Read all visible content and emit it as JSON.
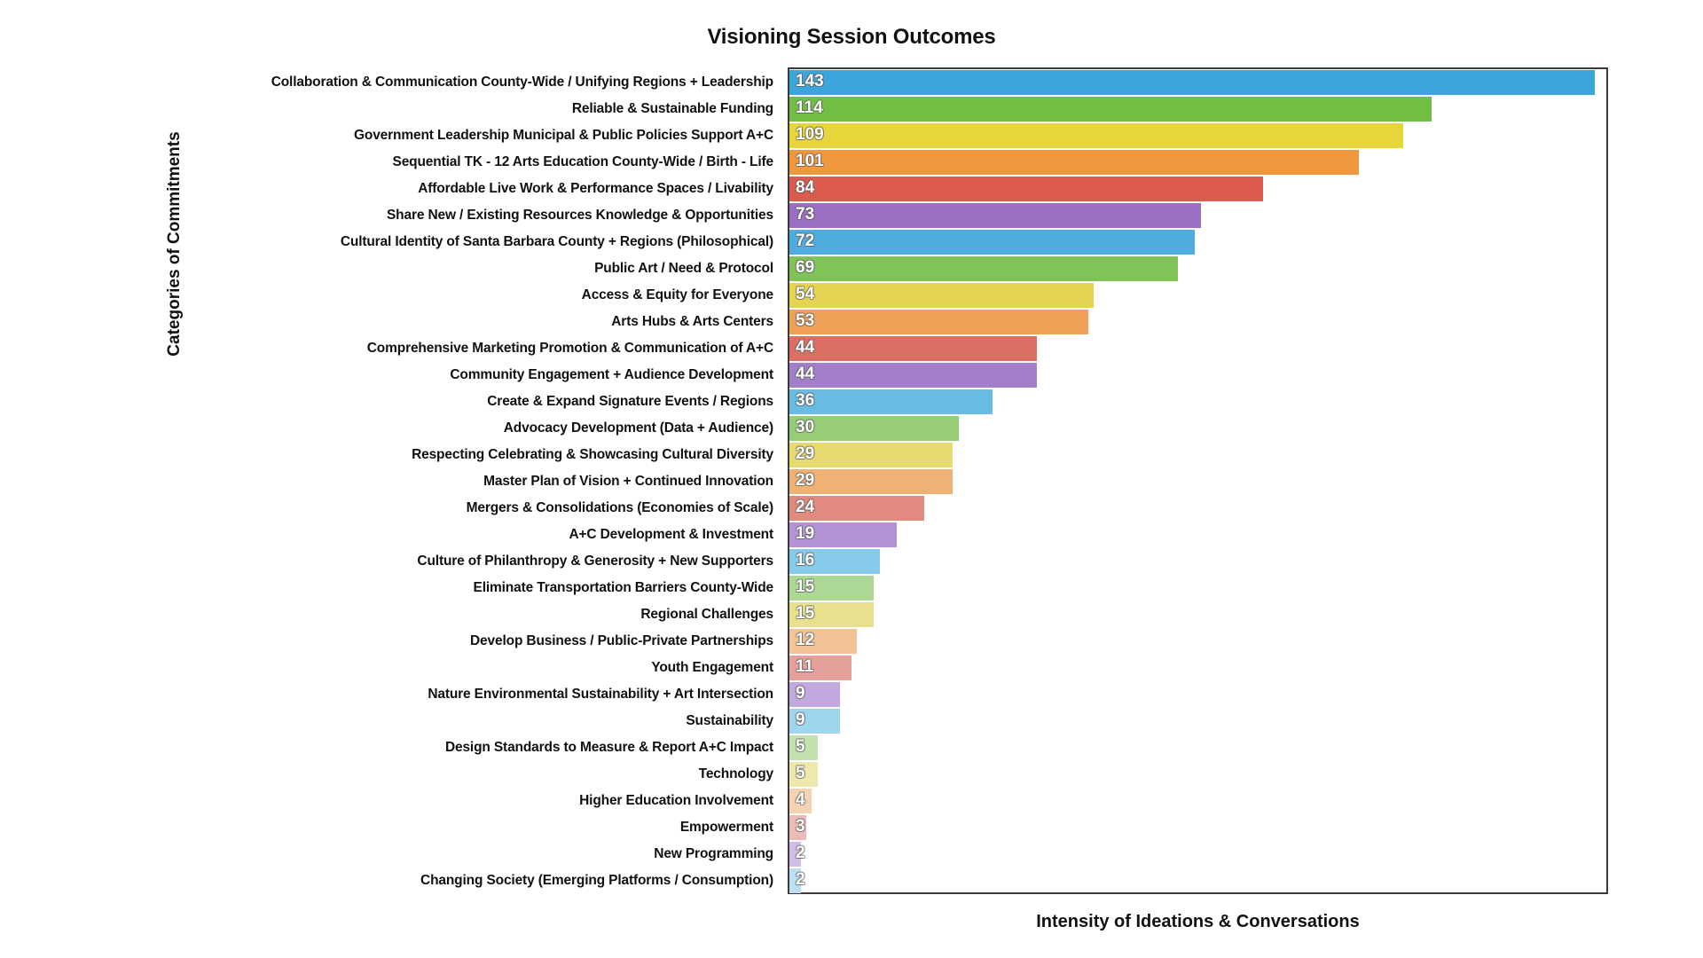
{
  "chart_data": {
    "type": "bar",
    "orientation": "horizontal",
    "title": "Visioning Session Outcomes",
    "xlabel": "Intensity of Ideations & Conversations",
    "ylabel": "Categories of Commitments",
    "grid": false,
    "legend": "none",
    "xlim": [
      0,
      145
    ],
    "categories": [
      "Collaboration & Communication County-Wide / Unifying Regions + Leadership",
      "Reliable & Sustainable Funding",
      "Government Leadership Municipal & Public Policies Support A+C",
      "Sequential TK - 12 Arts Education County-Wide / Birth - Life",
      "Affordable Live Work & Performance Spaces / Livability",
      "Share New / Existing Resources Knowledge & Opportunities",
      "Cultural Identity of Santa Barbara County + Regions (Philosophical)",
      "Public Art / Need & Protocol",
      "Access & Equity for Everyone",
      "Arts Hubs & Arts Centers",
      "Comprehensive Marketing Promotion & Communication of A+C",
      "Community Engagement + Audience Development",
      "Create & Expand Signature Events / Regions",
      "Advocacy Development (Data + Audience)",
      "Respecting Celebrating & Showcasing Cultural Diversity",
      "Master Plan of Vision + Continued Innovation",
      "Mergers & Consolidations (Economies of Scale)",
      "A+C Development & Investment",
      "Culture of Philanthropy & Generosity + New Supporters",
      "Eliminate Transportation Barriers County-Wide",
      "Regional Challenges",
      "Develop Business / Public-Private Partnerships",
      "Youth Engagement",
      "Nature Environmental Sustainability + Art Intersection",
      "Sustainability",
      "Design Standards to Measure & Report A+C Impact",
      "Technology",
      "Higher Education Involvement",
      "Empowerment",
      "New Programming",
      "Changing Society (Emerging Platforms / Consumption)"
    ],
    "values": [
      143,
      114,
      109,
      101,
      84,
      73,
      72,
      69,
      54,
      53,
      44,
      44,
      36,
      30,
      29,
      29,
      24,
      19,
      16,
      15,
      15,
      12,
      11,
      9,
      9,
      5,
      5,
      4,
      3,
      2,
      2
    ],
    "colors": [
      "#3BA5DC",
      "#72BE44",
      "#E8D53C",
      "#F0983D",
      "#DB5C4E",
      "#9B6FC4",
      "#4EACDE",
      "#80C457",
      "#E5D451",
      "#EFA257",
      "#DC6F63",
      "#A37FCA",
      "#68BBE3",
      "#97CD76",
      "#E7DB6F",
      "#F0B175",
      "#E08A80",
      "#B294D6",
      "#85CAE8",
      "#ACD795",
      "#E8E08D",
      "#F2C396",
      "#E5A09B",
      "#C1A8DF",
      "#9FD5ED",
      "#C2E0B0",
      "#EEE8AC",
      "#F5D2B2",
      "#ECBBB7",
      "#D2BDE8",
      "#BCDFF2"
    ]
  }
}
